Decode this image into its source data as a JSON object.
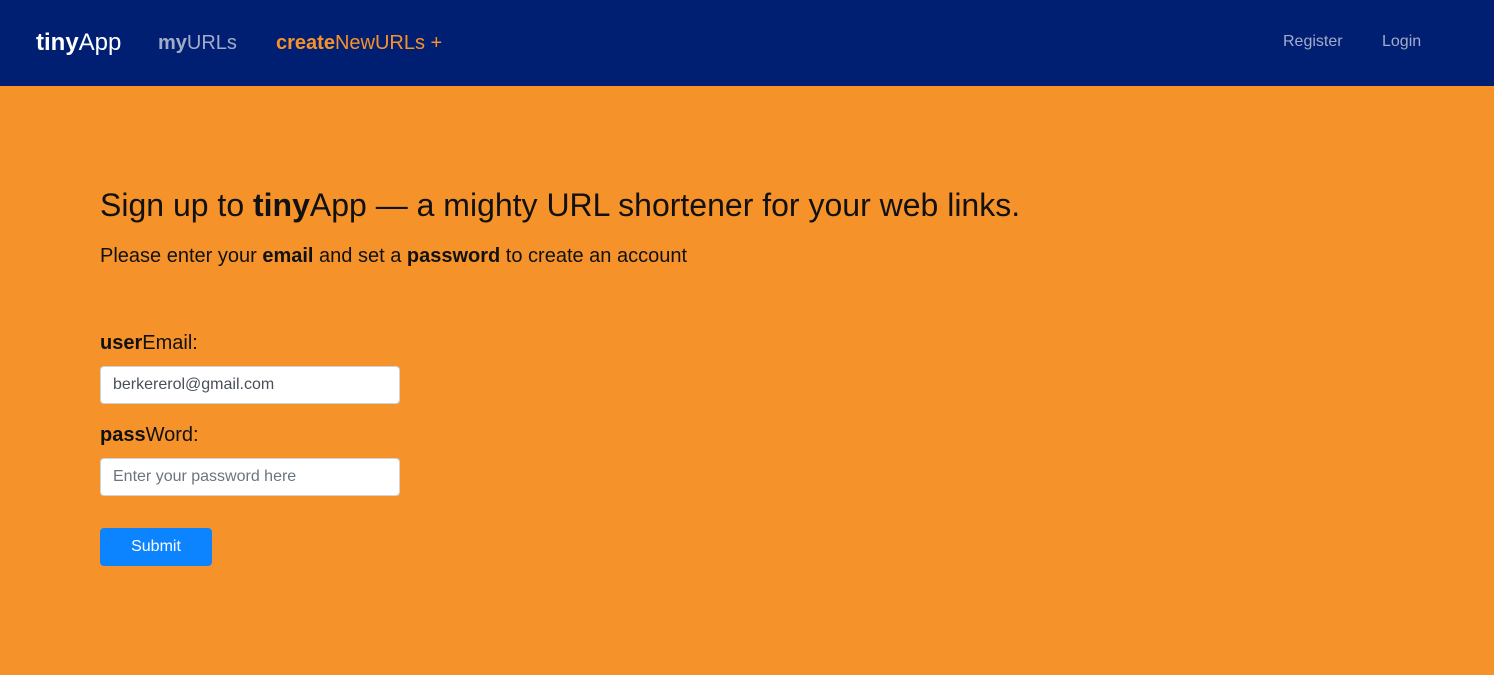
{
  "navbar": {
    "brand": {
      "bold": "tiny",
      "rest": "App"
    },
    "myurls": {
      "bold": "my",
      "rest": "URLs"
    },
    "create": {
      "bold": "create",
      "rest": "NewURLs +"
    },
    "register_label": "Register",
    "login_label": "Login"
  },
  "main": {
    "heading": {
      "before": "Sign up to ",
      "bold": "tiny",
      "after": "App — a mighty URL shortener for your web links."
    },
    "subheading": {
      "part1": "Please enter your ",
      "bold1": "email",
      "part2": " and set a ",
      "bold2": "password",
      "part3": " to create an account"
    },
    "form": {
      "email_label": {
        "bold": "user",
        "rest": "Email:"
      },
      "email_value": "berkererol@gmail.com",
      "password_label": {
        "bold": "pass",
        "rest": "Word:"
      },
      "password_placeholder": "Enter your password here",
      "password_value": "",
      "submit_label": "Submit"
    }
  },
  "colors": {
    "navbar_bg": "#001f73",
    "page_bg": "#f6922a",
    "accent": "#f6922a",
    "nav_muted": "#a3abc8",
    "submit_bg": "#0d84ff"
  }
}
